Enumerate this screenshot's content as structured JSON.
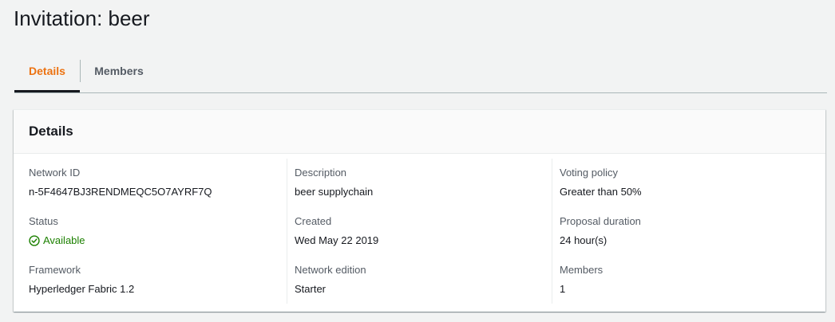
{
  "page": {
    "title": "Invitation: beer"
  },
  "tabs": [
    {
      "label": "Details",
      "active": true
    },
    {
      "label": "Members",
      "active": false
    }
  ],
  "panel": {
    "title": "Details",
    "columns": [
      [
        {
          "label": "Network ID",
          "value": "n-5F4647BJ3RENDMEQC5O7AYRF7Q"
        },
        {
          "label": "Status",
          "value": "Available",
          "icon": "check-circle-icon",
          "color": "#1d8102"
        },
        {
          "label": "Framework",
          "value": "Hyperledger Fabric 1.2"
        }
      ],
      [
        {
          "label": "Description",
          "value": "beer supplychain"
        },
        {
          "label": "Created",
          "value": "Wed May 22 2019"
        },
        {
          "label": "Network edition",
          "value": "Starter"
        }
      ],
      [
        {
          "label": "Voting policy",
          "value": "Greater than 50%"
        },
        {
          "label": "Proposal duration",
          "value": "24 hour(s)"
        },
        {
          "label": "Members",
          "value": "1"
        }
      ]
    ]
  },
  "colors": {
    "accent": "#ec7211",
    "success": "#1d8102",
    "text": "#16191f",
    "muted": "#545b64",
    "background": "#f2f3f3"
  }
}
